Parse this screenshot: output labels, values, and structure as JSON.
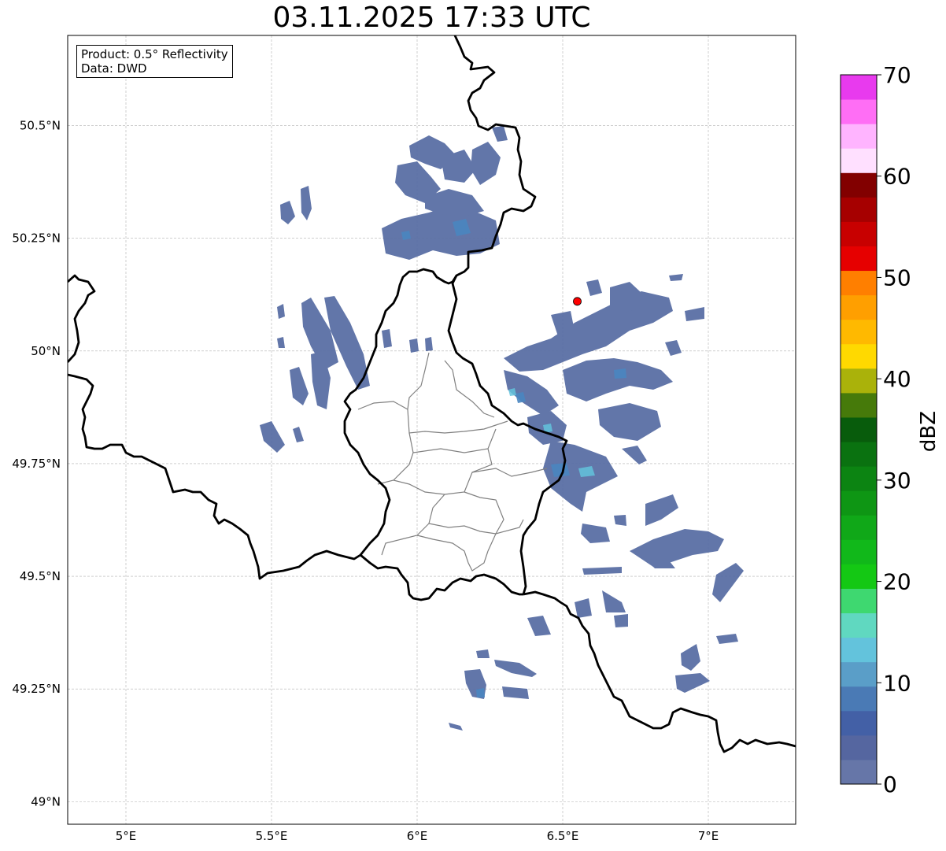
{
  "title": "03.11.2025 17:33 UTC",
  "info": {
    "product_line": "Product: 0.5° Reflectivity",
    "data_line": "Data: DWD"
  },
  "map": {
    "lon_range": [
      4.8,
      7.3
    ],
    "lat_range": [
      48.95,
      50.7
    ],
    "lon_ticks": [
      {
        "value": 5.0,
        "label": "5°E"
      },
      {
        "value": 5.5,
        "label": "5.5°E"
      },
      {
        "value": 6.0,
        "label": "6°E"
      },
      {
        "value": 6.5,
        "label": "6.5°E"
      },
      {
        "value": 7.0,
        "label": "7°E"
      }
    ],
    "lat_ticks": [
      {
        "value": 49.0,
        "label": "49°N"
      },
      {
        "value": 49.25,
        "label": "49.25°N"
      },
      {
        "value": 49.5,
        "label": "49.5°N"
      },
      {
        "value": 49.75,
        "label": "49.75°N"
      },
      {
        "value": 50.0,
        "label": "50°N"
      },
      {
        "value": 50.25,
        "label": "50.25°N"
      },
      {
        "value": 50.5,
        "label": "50.5°N"
      }
    ],
    "gridlines": true,
    "radar_site": {
      "lon": 6.55,
      "lat": 50.11,
      "color": "#ff0000"
    },
    "colors": {
      "echo_main": "#5a6fa5",
      "echo_light": "#4a86c0",
      "echo_cyan": "#63c3dc",
      "border": "#000000",
      "admin": "#808080",
      "grid": "#b0b0b0"
    }
  },
  "colorbar": {
    "label": "dBZ",
    "min": 0,
    "max": 70,
    "ticks": [
      {
        "value": 0,
        "label": "0"
      },
      {
        "value": 10,
        "label": "10"
      },
      {
        "value": 20,
        "label": "20"
      },
      {
        "value": 30,
        "label": "30"
      },
      {
        "value": 40,
        "label": "40"
      },
      {
        "value": 50,
        "label": "50"
      },
      {
        "value": 60,
        "label": "60"
      },
      {
        "value": 70,
        "label": "70"
      }
    ],
    "colors": [
      "#6676a8",
      "#5566a0",
      "#4360a6",
      "#4a7ab5",
      "#5a9ec8",
      "#63c3dc",
      "#60d8c0",
      "#3ed870",
      "#14c814",
      "#11b81a",
      "#10a818",
      "#0e9614",
      "#0c8412",
      "#0a7210",
      "#085c0c",
      "#467a0a",
      "#aab20a",
      "#ffd900",
      "#ffb900",
      "#ff9f00",
      "#ff7f00",
      "#e60000",
      "#c80000",
      "#a60000",
      "#820000",
      "#ffe0ff",
      "#ffb4ff",
      "#ff6ef5",
      "#e83aee"
    ]
  }
}
